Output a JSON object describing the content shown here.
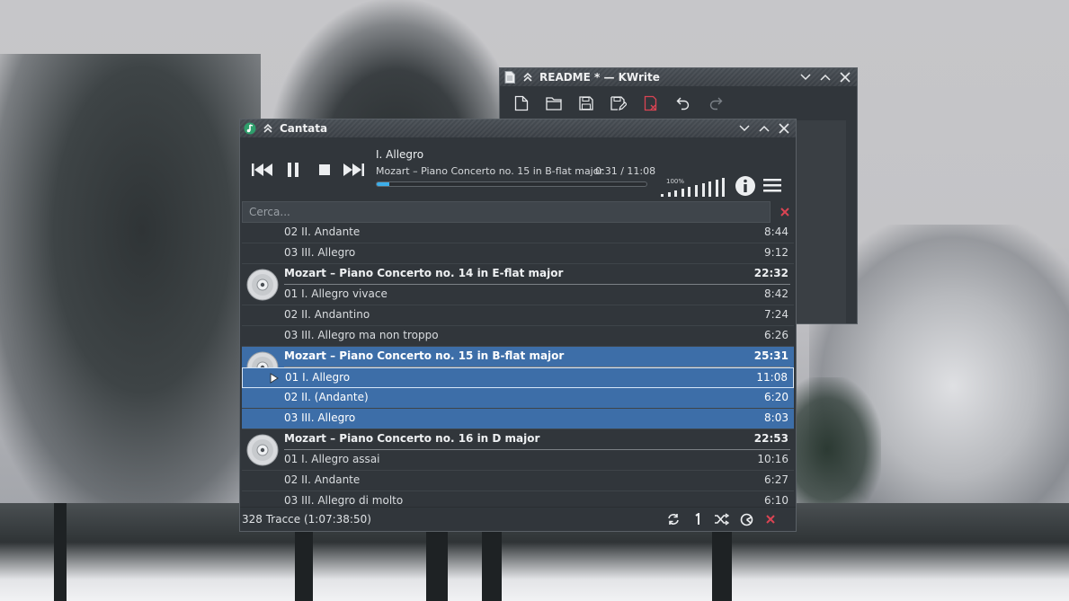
{
  "kwrite": {
    "title": "README * — KWrite",
    "icons": [
      "document-icon",
      "new-file-icon",
      "open-folder-icon",
      "save-icon",
      "save-as-icon",
      "close-document-icon",
      "undo-icon",
      "redo-icon"
    ]
  },
  "cantata": {
    "title": "Cantata",
    "now_playing": {
      "title": "I. Allegro",
      "subtitle": "Mozart – Piano Concerto no. 15 in B-flat major",
      "time": "0:31 / 11:08",
      "progress": 0.046
    },
    "volume": {
      "label": "100%",
      "level": 1.0
    },
    "search": {
      "placeholder": "Cerca...",
      "value": ""
    },
    "playlist": [
      {
        "kind": "track",
        "name": "02 II. Andante",
        "duration": "8:44"
      },
      {
        "kind": "track",
        "name": "03 III. Allegro",
        "duration": "9:12"
      },
      {
        "kind": "album",
        "name": "Mozart – Piano Concerto no. 14 in E-flat major",
        "duration": "22:32"
      },
      {
        "kind": "track",
        "name": "01 I. Allegro vivace",
        "duration": "8:42"
      },
      {
        "kind": "track",
        "name": "02 II. Andantino",
        "duration": "7:24"
      },
      {
        "kind": "track",
        "name": "03 III. Allegro ma non troppo",
        "duration": "6:26"
      },
      {
        "kind": "album",
        "name": "Mozart – Piano Concerto no. 15 in B-flat major",
        "duration": "25:31",
        "selected": true
      },
      {
        "kind": "track",
        "name": "01 I. Allegro",
        "duration": "11:08",
        "selected": true,
        "current": true
      },
      {
        "kind": "track",
        "name": "02 II. (Andante)",
        "duration": "6:20",
        "selected": true
      },
      {
        "kind": "track",
        "name": "03 III. Allegro",
        "duration": "8:03",
        "selected": true
      },
      {
        "kind": "album",
        "name": "Mozart – Piano Concerto no. 16 in D major",
        "duration": "22:53"
      },
      {
        "kind": "track",
        "name": "01 I. Allegro assai",
        "duration": "10:16"
      },
      {
        "kind": "track",
        "name": "02 II. Andante",
        "duration": "6:27"
      },
      {
        "kind": "track",
        "name": "03 III. Allegro di molto",
        "duration": "6:10"
      }
    ],
    "status": {
      "count": "328 Tracce (1:07:38:50)",
      "icons": [
        "repeat-icon",
        "single-track-icon",
        "shuffle-icon",
        "consume-icon",
        "clear-playlist-icon"
      ]
    }
  },
  "colors": {
    "accent": "#3daee9",
    "selection": "#3d6ea8",
    "window_bg": "#31363b",
    "danger": "#da4453"
  }
}
